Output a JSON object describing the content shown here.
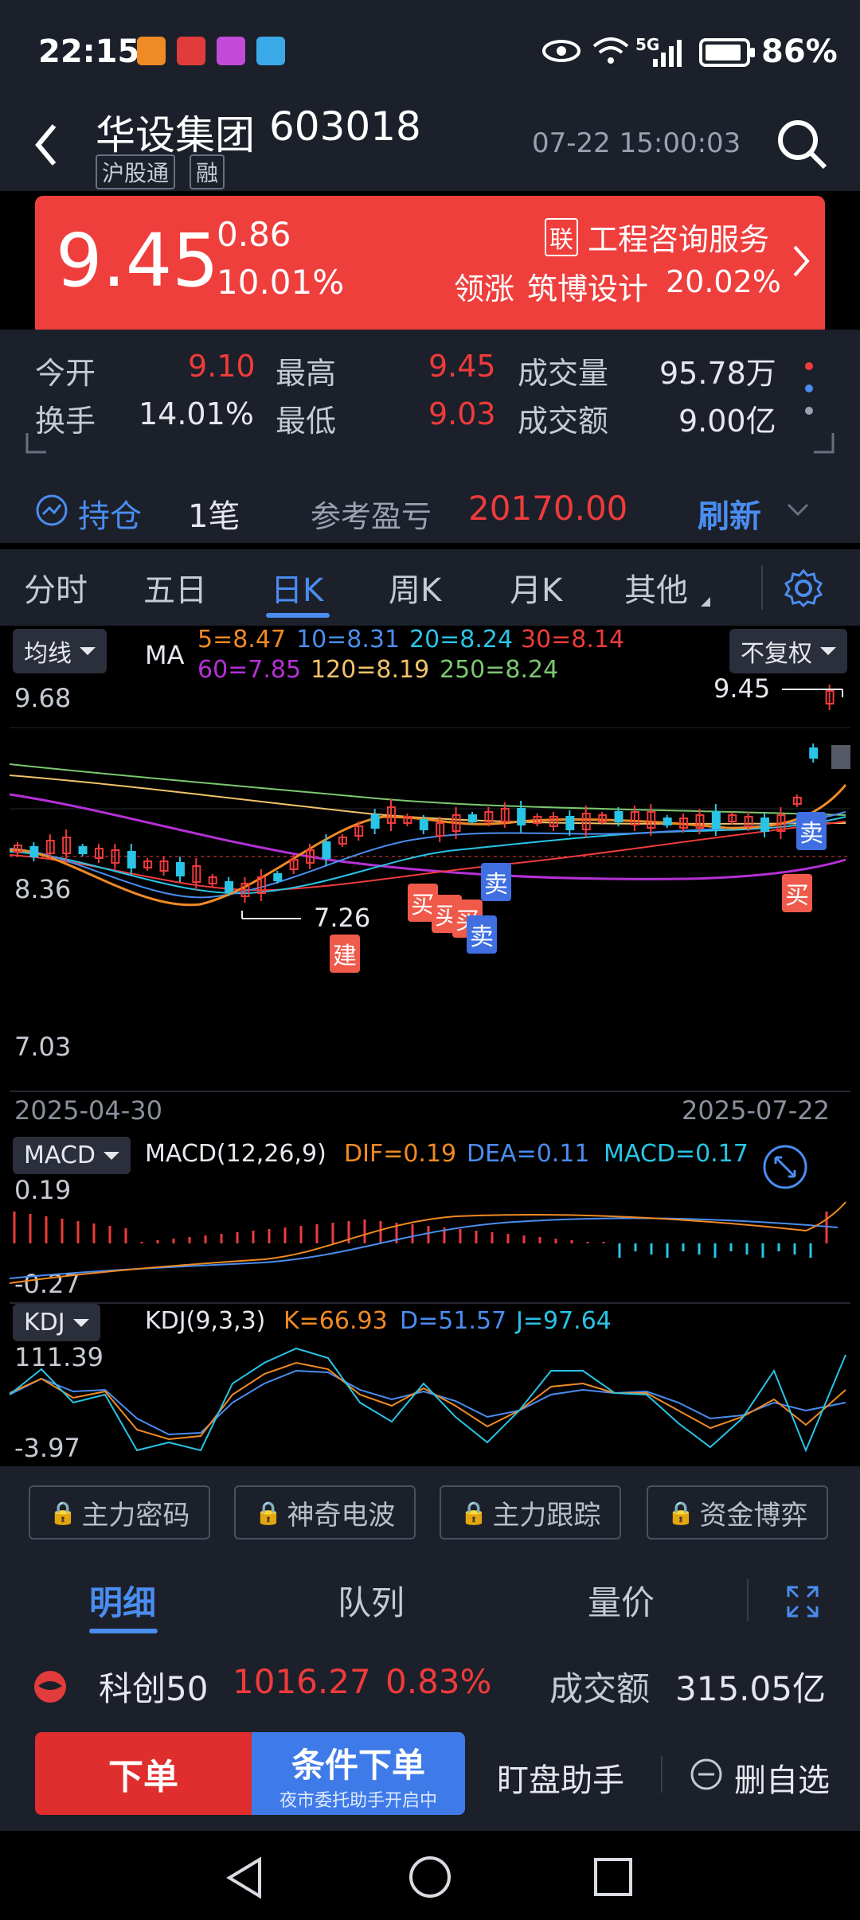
{
  "status": {
    "time": "22:15",
    "battery": "86%",
    "signal": "5G"
  },
  "header": {
    "back_icon": "chevron-left-icon",
    "stock_name": "华设集团",
    "stock_code": "603018",
    "tag_1": "沪股通",
    "tag_2": "融",
    "datetime": "07-22 15:00:03",
    "search_icon": "search-icon"
  },
  "price": {
    "last": "9.45",
    "change": "0.86",
    "change_pct": "10.01%",
    "lian_tag": "联",
    "industry": "工程咨询服务",
    "lead_label": "领涨",
    "lead_stock": "筑博设计",
    "lead_pct": "20.02%",
    "bg_color": "#ef3f3d"
  },
  "stats": {
    "open_label": "今开",
    "open": "9.10",
    "high_label": "最高",
    "high": "9.45",
    "volume_label": "成交量",
    "volume": "95.78万",
    "turnover_label": "换手",
    "turnover": "14.01%",
    "low_label": "最低",
    "low": "9.03",
    "amount_label": "成交额",
    "amount": "9.00亿"
  },
  "holding": {
    "label": "持仓",
    "count": "1笔",
    "pnl_label": "参考盈亏",
    "pnl": "20170.00",
    "refresh": "刷新"
  },
  "tabs": [
    "分时",
    "五日",
    "日K",
    "周K",
    "月K",
    "其他"
  ],
  "active_tab": "日K",
  "ma_panel": {
    "selector": "均线",
    "prefix": "MA",
    "adjust": "不复权",
    "ma5": "5=8.47",
    "ma10": "10=8.31",
    "ma20": "20=8.24",
    "ma30": "30=8.14",
    "ma60": "60=7.85",
    "ma120": "120=8.19",
    "ma250": "250=8.24",
    "y_top": "9.68",
    "y_mid": "8.36",
    "y_bottom": "7.03",
    "max_label": "9.45",
    "min_label": "7.26",
    "date_start": "2025-04-30",
    "date_end": "2025-07-22",
    "signals": [
      "建",
      "买",
      "买",
      "买",
      "卖",
      "卖",
      "卖",
      "买"
    ]
  },
  "macd_panel": {
    "selector": "MACD",
    "params": "MACD(12,26,9)",
    "dif": "DIF=0.19",
    "dea": "DEA=0.11",
    "macd": "MACD=0.17",
    "y_top": "0.19",
    "y_bottom": "-0.27"
  },
  "kdj_panel": {
    "selector": "KDJ",
    "params": "KDJ(9,3,3)",
    "k": "K=66.93",
    "d": "D=51.57",
    "j": "J=97.64",
    "y_top": "111.39",
    "y_bottom": "-3.97"
  },
  "features": [
    "主力密码",
    "神奇电波",
    "主力跟踪",
    "资金博弈"
  ],
  "sub_tabs": [
    "明细",
    "队列",
    "量价"
  ],
  "index": {
    "name": "科创50",
    "value": "1016.27",
    "pct": "0.83%",
    "amount_label": "成交额",
    "amount": "315.05亿"
  },
  "actions": {
    "order": "下单",
    "conditional": "条件下单",
    "conditional_sub": "夜市委托助手开启中",
    "watch": "盯盘助手",
    "remove_watch": "删自选"
  },
  "colors": {
    "up": "#ef3b3b",
    "down": "#29c4e6",
    "accent": "#4a8df0",
    "ma5": "#f08a24",
    "ma10": "#4a8df0",
    "ma20": "#29c4e6",
    "ma30": "#ef3b3b",
    "ma60": "#b531d6",
    "ma120": "#f2c36b",
    "ma250": "#7bc96f"
  }
}
